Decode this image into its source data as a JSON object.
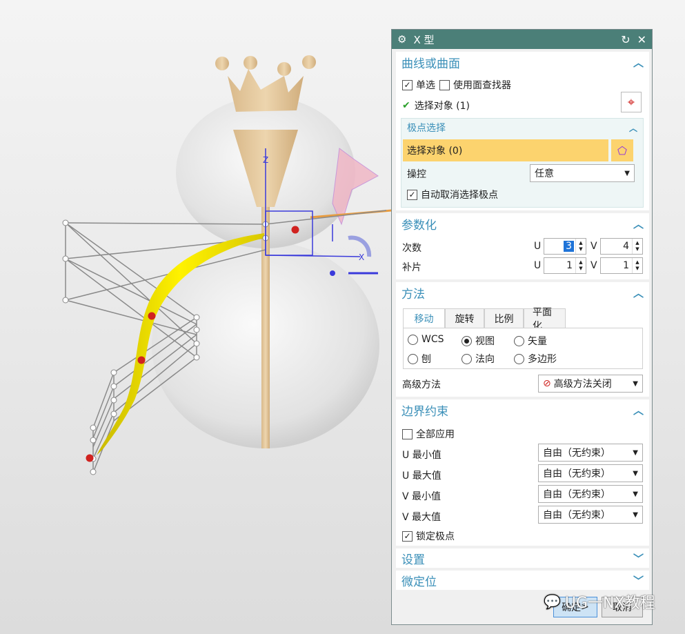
{
  "dialog": {
    "title": "X 型",
    "sections": {
      "curve_surface": {
        "title": "曲线或曲面",
        "single_select": "单选",
        "use_face_finder": "使用面查找器",
        "select_object": "选择对象 (1)",
        "pole_select": {
          "title": "极点选择",
          "select_object": "选择对象 (0)",
          "manip_label": "操控",
          "manip_value": "任意",
          "auto_deselect": "自动取消选择极点"
        }
      },
      "parametrization": {
        "title": "参数化",
        "degree_label": "次数",
        "patch_label": "补片",
        "u_label": "U",
        "v_label": "V",
        "degree_u": "3",
        "degree_v": "4",
        "patch_u": "1",
        "patch_v": "1"
      },
      "method": {
        "title": "方法",
        "tabs": [
          "移动",
          "旋转",
          "比例",
          "平面化"
        ],
        "radios": [
          "WCS",
          "视图",
          "矢量",
          "刨",
          "法向",
          "多边形"
        ],
        "advanced_label": "高级方法",
        "advanced_value": "高级方法关闭"
      },
      "boundary": {
        "title": "边界约束",
        "apply_all": "全部应用",
        "rows": [
          {
            "label": "U 最小值",
            "value": "自由（无约束）"
          },
          {
            "label": "U 最大值",
            "value": "自由（无约束）"
          },
          {
            "label": "V 最小值",
            "value": "自由（无约束）"
          },
          {
            "label": "V 最大值",
            "value": "自由（无约束）"
          }
        ],
        "lock_poles": "锁定极点"
      },
      "settings": {
        "title": "设置"
      },
      "micro": {
        "title": "微定位"
      }
    },
    "footer": {
      "ok": "确定",
      "cancel": "取消"
    }
  },
  "watermark": "UG一NX教程",
  "viewport": {
    "axis_z": "Z",
    "axis_x": "X"
  },
  "colors": {
    "title_bar": "#4b7f78",
    "section_header": "#3a8fb8",
    "highlight": "#fcd36e",
    "surface": "#f2e200"
  }
}
